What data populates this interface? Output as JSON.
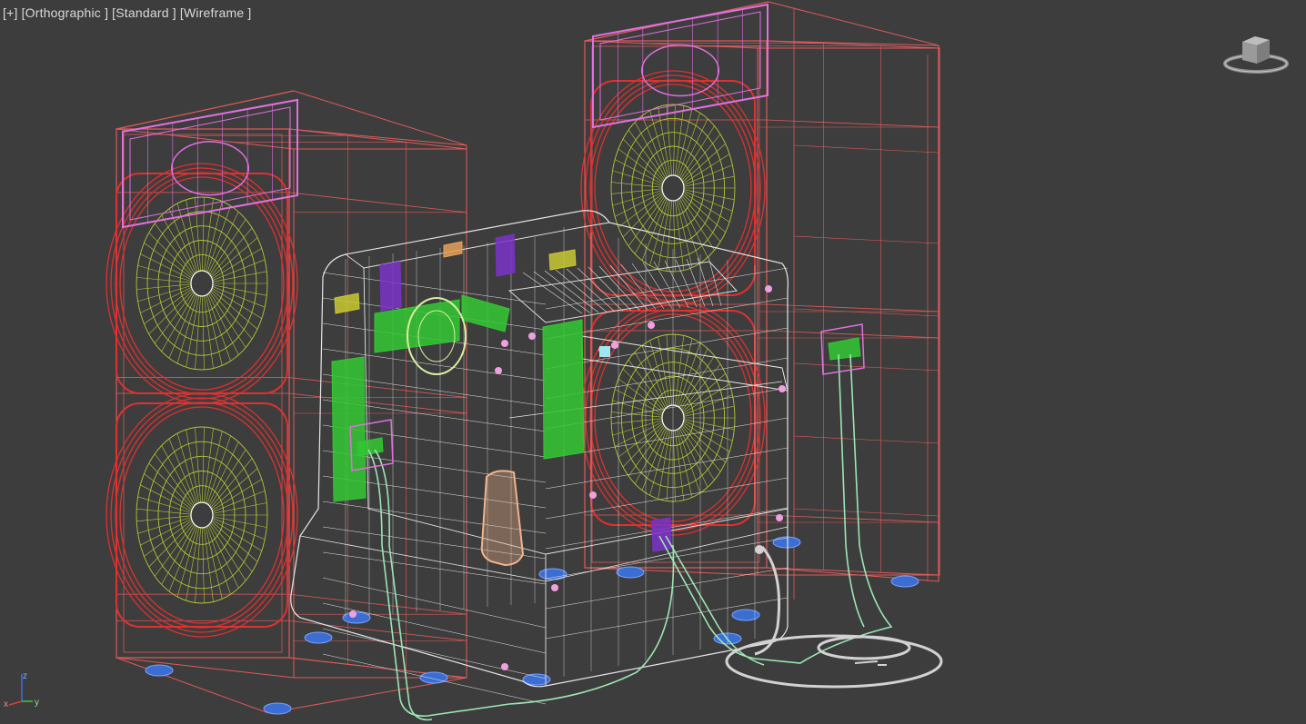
{
  "viewport": {
    "menu_plus": "[+]",
    "view_label": "[Orthographic ]",
    "shading_label": "[Standard ]",
    "display_label": "[Wireframe ]"
  },
  "axes": {
    "z": "z",
    "x": "x",
    "y": "y"
  },
  "viewcube": {
    "icon": "viewcube-icon"
  },
  "colors": {
    "background": "#3d3d3d",
    "cabinet_wire": "#e05a5a",
    "driver_ring": "#e03030",
    "driver_cone": "#b4c832",
    "tweeter_head": "#e070e0",
    "center_unit": "#e6e6e6",
    "cable": "#9ce6b4",
    "power_cord": "#d2d2d2",
    "feet": "#3c6ed2",
    "green_parts": "#32c832",
    "purple_parts": "#7a32c8"
  }
}
